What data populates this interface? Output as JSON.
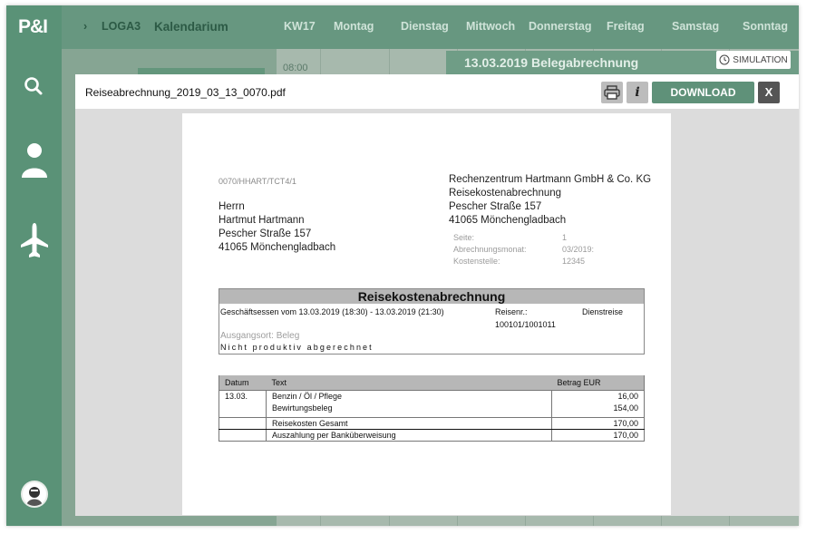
{
  "app": {
    "logo": "P&I",
    "breadcrumb_arrow": "›",
    "breadcrumb_module": "LOGA3",
    "breadcrumb_page": "Kalendarium"
  },
  "calendar": {
    "week": "KW17",
    "days": [
      "Montag",
      "Dienstag",
      "Mittwoch",
      "Donnerstag",
      "Freitag",
      "Samstag",
      "Sonntag"
    ],
    "time_first": "08:00",
    "event_title": "13.03.2019 Belegabrechnung",
    "simulation_label": "SIMULATION"
  },
  "sidebar": {
    "icons": [
      "search-icon",
      "user-icon",
      "airplane-icon"
    ]
  },
  "modal": {
    "filename": "Reiseabrechnung_2019_03_13_0070.pdf",
    "info_label": "i",
    "download_label": "DOWNLOAD",
    "close_label": "X"
  },
  "document": {
    "reference": "0070/HHART/TCT4/1",
    "recipient": [
      "Herrn",
      "Hartmut Hartmann",
      "Pescher Straße 157",
      "41065 Mönchengladbach"
    ],
    "company": [
      "Rechenzentrum Hartmann GmbH & Co. KG",
      "Reisekostenabrechnung",
      "Pescher Straße 157",
      "41065 Mönchengladbach"
    ],
    "meta": [
      {
        "key": "Seite:",
        "value": "1"
      },
      {
        "key": "Abrechnungsmonat:",
        "value": "03/2019:"
      },
      {
        "key": "Kostenstelle:",
        "value": "12345"
      }
    ],
    "heading": "Reisekostenabrechnung",
    "trip_line": "Geschäftsessen vom 13.03.2019 (18:30) - 13.03.2019 (21:30)",
    "trip_no_label": "Reisenr.:",
    "trip_no": "100101/1001011",
    "trip_type": "Dienstreise",
    "origin": "Ausgangsort: Beleg",
    "non_productive": "Nicht produktiv abgerechnet",
    "table": {
      "headers": [
        "Datum",
        "Text",
        "Betrag EUR"
      ],
      "date": "13.03.",
      "items": [
        {
          "text": "Benzin / Öl / Pflege",
          "amount": "16,00"
        },
        {
          "text": "Bewirtungsbeleg",
          "amount": "154,00"
        }
      ],
      "total_label": "Reisekosten Gesamt",
      "total": "170,00",
      "payout_label": "Auszahlung per Banküberweisung",
      "payout": "170,00"
    }
  },
  "colors": {
    "sidebar": "#5a9277",
    "download": "#5f9179",
    "table_header": "#b7b7b7"
  }
}
